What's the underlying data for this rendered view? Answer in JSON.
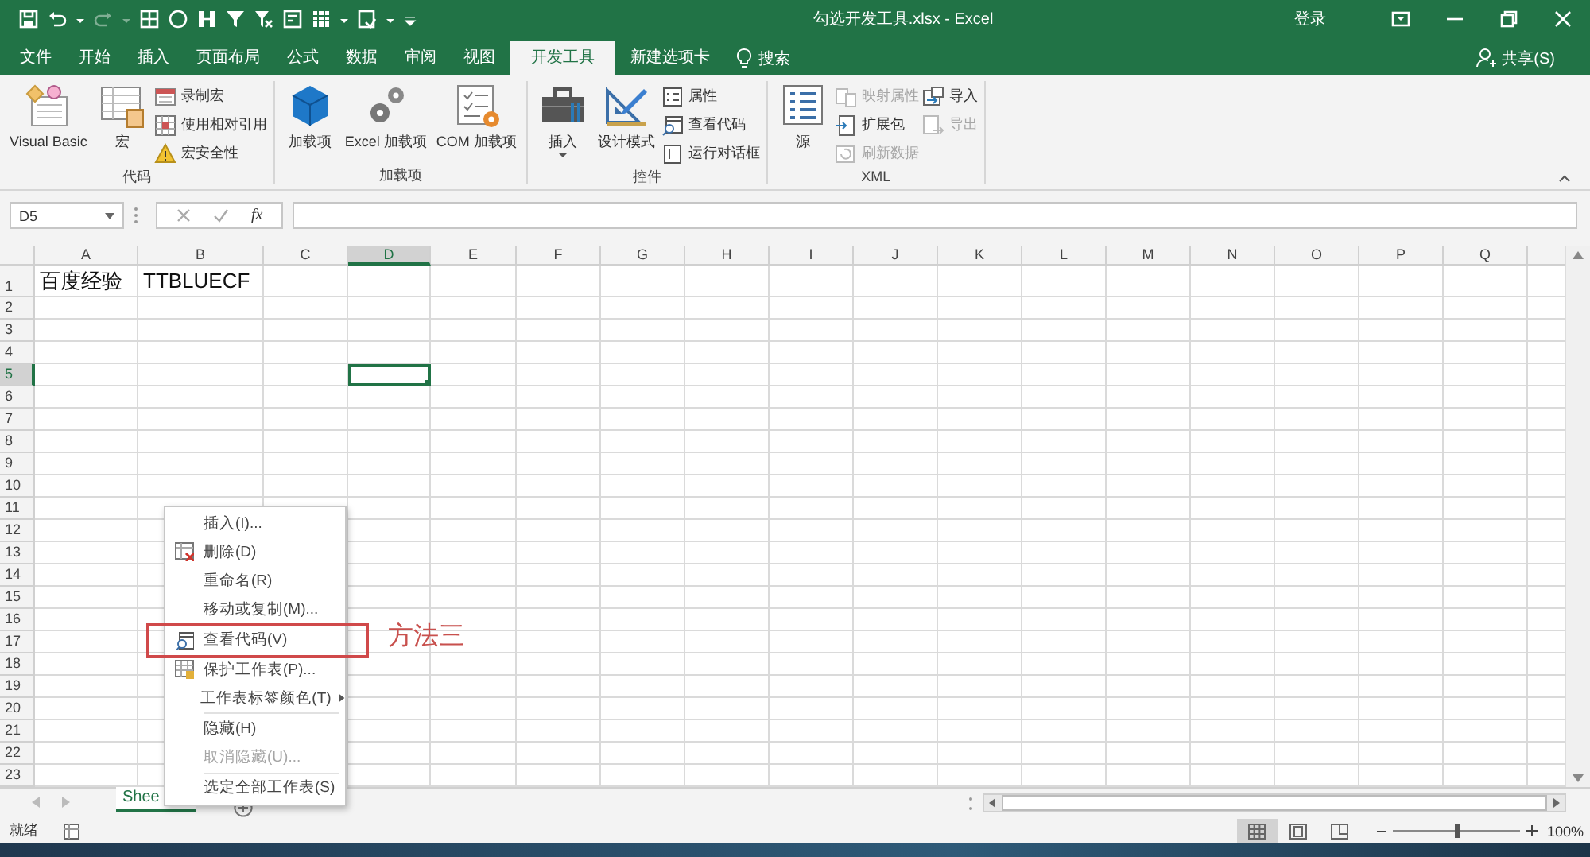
{
  "title_bar": {
    "title": "勾选开发工具.xlsx - Excel",
    "sign_in": "登录"
  },
  "ribbon_tabs": [
    {
      "label": "文件",
      "selected": false
    },
    {
      "label": "开始",
      "selected": false
    },
    {
      "label": "插入",
      "selected": false
    },
    {
      "label": "页面布局",
      "selected": false
    },
    {
      "label": "公式",
      "selected": false
    },
    {
      "label": "数据",
      "selected": false
    },
    {
      "label": "审阅",
      "selected": false
    },
    {
      "label": "视图",
      "selected": false
    },
    {
      "label": "开发工具",
      "selected": true
    },
    {
      "label": "新建选项卡",
      "selected": false
    }
  ],
  "search": {
    "label": "搜索"
  },
  "share": "共享(S)",
  "ribbon_groups": [
    {
      "name": "代码",
      "items": [
        {
          "label": "Visual Basic",
          "kind": "large",
          "disabled": false
        },
        {
          "label": "宏",
          "kind": "large",
          "disabled": false
        },
        {
          "label": "录制宏",
          "kind": "small",
          "disabled": false
        },
        {
          "label": "使用相对引用",
          "kind": "small",
          "disabled": false
        },
        {
          "label": "宏安全性",
          "kind": "small",
          "disabled": false
        }
      ]
    },
    {
      "name": "加载项",
      "items": [
        {
          "label": "加载项",
          "kind": "large",
          "disabled": false
        },
        {
          "label": "Excel 加载项",
          "kind": "large",
          "disabled": false
        },
        {
          "label": "COM 加载项",
          "kind": "large",
          "disabled": false
        }
      ]
    },
    {
      "name": "控件",
      "items": [
        {
          "label": "插入",
          "kind": "large",
          "disabled": false,
          "dropdown": true
        },
        {
          "label": "设计模式",
          "kind": "large",
          "disabled": false
        },
        {
          "label": "属性",
          "kind": "small",
          "disabled": false
        },
        {
          "label": "查看代码",
          "kind": "small",
          "disabled": false
        },
        {
          "label": "运行对话框",
          "kind": "small",
          "disabled": false
        }
      ]
    },
    {
      "name": "XML",
      "items": [
        {
          "label": "源",
          "kind": "large",
          "disabled": false
        },
        {
          "label": "映射属性",
          "kind": "small",
          "disabled": true
        },
        {
          "label": "扩展包",
          "kind": "small",
          "disabled": false
        },
        {
          "label": "刷新数据",
          "kind": "small",
          "disabled": true
        },
        {
          "label": "导入",
          "kind": "small",
          "disabled": false
        },
        {
          "label": "导出",
          "kind": "small",
          "disabled": true
        }
      ]
    }
  ],
  "formula_bar": {
    "name_box": "D5",
    "function_button": "fx"
  },
  "columns": [
    {
      "label": "A",
      "selected": false
    },
    {
      "label": "B",
      "selected": false
    },
    {
      "label": "C",
      "selected": false
    },
    {
      "label": "D",
      "selected": true
    },
    {
      "label": "E",
      "selected": false
    },
    {
      "label": "F",
      "selected": false
    },
    {
      "label": "G",
      "selected": false
    },
    {
      "label": "H",
      "selected": false
    },
    {
      "label": "I",
      "selected": false
    },
    {
      "label": "J",
      "selected": false
    },
    {
      "label": "K",
      "selected": false
    },
    {
      "label": "L",
      "selected": false
    },
    {
      "label": "M",
      "selected": false
    },
    {
      "label": "N",
      "selected": false
    },
    {
      "label": "O",
      "selected": false
    },
    {
      "label": "P",
      "selected": false
    },
    {
      "label": "Q",
      "selected": false
    }
  ],
  "rows": [
    {
      "number": "1",
      "selected": false,
      "cells": [
        "百度经验",
        "TTBLUECF"
      ]
    },
    {
      "number": "2",
      "selected": false
    },
    {
      "number": "3",
      "selected": false
    },
    {
      "number": "4",
      "selected": false
    },
    {
      "number": "5",
      "selected": true
    },
    {
      "number": "6",
      "selected": false
    },
    {
      "number": "7",
      "selected": false
    },
    {
      "number": "8",
      "selected": false
    },
    {
      "number": "9",
      "selected": false
    },
    {
      "number": "10",
      "selected": false
    },
    {
      "number": "11",
      "selected": false
    },
    {
      "number": "12",
      "selected": false
    },
    {
      "number": "13",
      "selected": false
    },
    {
      "number": "14",
      "selected": false
    },
    {
      "number": "15",
      "selected": false
    },
    {
      "number": "16",
      "selected": false
    },
    {
      "number": "17",
      "selected": false
    },
    {
      "number": "18",
      "selected": false
    },
    {
      "number": "19",
      "selected": false
    },
    {
      "number": "20",
      "selected": false
    },
    {
      "number": "21",
      "selected": false
    },
    {
      "number": "22",
      "selected": false
    },
    {
      "number": "23",
      "selected": false
    }
  ],
  "context_menu": {
    "items": [
      {
        "kind": "item",
        "label": "插入(I)...",
        "has_icon": false,
        "disabled": false,
        "submenu": false,
        "annotated": false
      },
      {
        "kind": "item",
        "label": "删除(D)",
        "has_icon": true,
        "disabled": false,
        "submenu": false,
        "annotated": false
      },
      {
        "kind": "item",
        "label": "重命名(R)",
        "has_icon": false,
        "disabled": false,
        "submenu": false,
        "annotated": false
      },
      {
        "kind": "item",
        "label": "移动或复制(M)...",
        "has_icon": false,
        "disabled": false,
        "submenu": false,
        "annotated": false
      },
      {
        "kind": "item",
        "label": "查看代码(V)",
        "has_icon": true,
        "disabled": false,
        "submenu": false,
        "annotated": true
      },
      {
        "kind": "item",
        "label": "保护工作表(P)...",
        "has_icon": true,
        "disabled": false,
        "submenu": false,
        "annotated": false
      },
      {
        "kind": "item",
        "label": "工作表标签颜色(T)",
        "has_icon": false,
        "disabled": false,
        "submenu": true,
        "annotated": false
      },
      {
        "kind": "separator"
      },
      {
        "kind": "item",
        "label": "隐藏(H)",
        "has_icon": false,
        "disabled": false,
        "submenu": false,
        "annotated": false
      },
      {
        "kind": "item",
        "label": "取消隐藏(U)...",
        "has_icon": false,
        "disabled": true,
        "submenu": false,
        "annotated": false
      },
      {
        "kind": "separator"
      },
      {
        "kind": "item",
        "label": "选定全部工作表(S)",
        "has_icon": false,
        "disabled": false,
        "submenu": false,
        "annotated": false
      }
    ]
  },
  "annotation": {
    "text": "方法三"
  },
  "sheet_tabs": [
    {
      "label": "Shee",
      "selected": true
    }
  ],
  "status_bar": {
    "status": "就绪",
    "zoom": "100%",
    "zoom_slider": {
      "level": 0.5
    }
  }
}
